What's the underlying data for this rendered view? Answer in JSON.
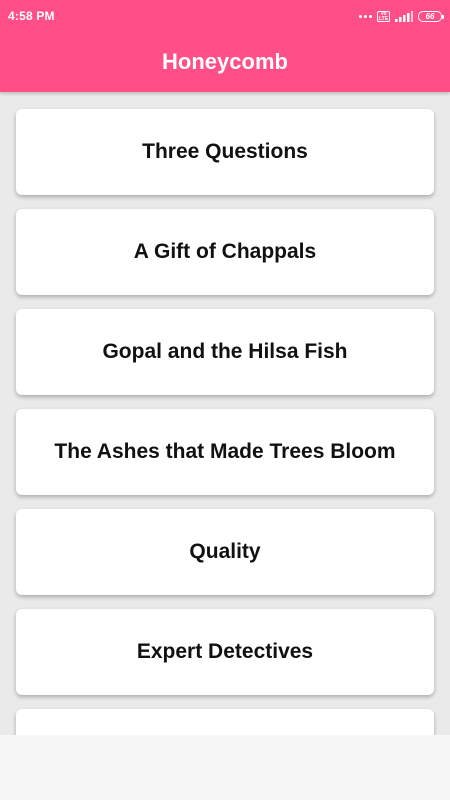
{
  "status_bar": {
    "time": "4:58 PM",
    "network_badge": "Vo LTE",
    "battery": "66",
    "icons": [
      "more-dots-icon",
      "volte-icon",
      "signal-icon",
      "battery-icon"
    ]
  },
  "app_bar": {
    "title": "Honeycomb"
  },
  "colors": {
    "accent": "#ff4f86",
    "background": "#eaeaea",
    "card": "#ffffff",
    "text": "#111111"
  },
  "chapters": [
    {
      "title": "Three Questions"
    },
    {
      "title": "A Gift of Chappals"
    },
    {
      "title": "Gopal and the Hilsa Fish"
    },
    {
      "title": "The Ashes that Made Trees Bloom"
    },
    {
      "title": "Quality"
    },
    {
      "title": "Expert Detectives"
    },
    {
      "title": ""
    }
  ]
}
